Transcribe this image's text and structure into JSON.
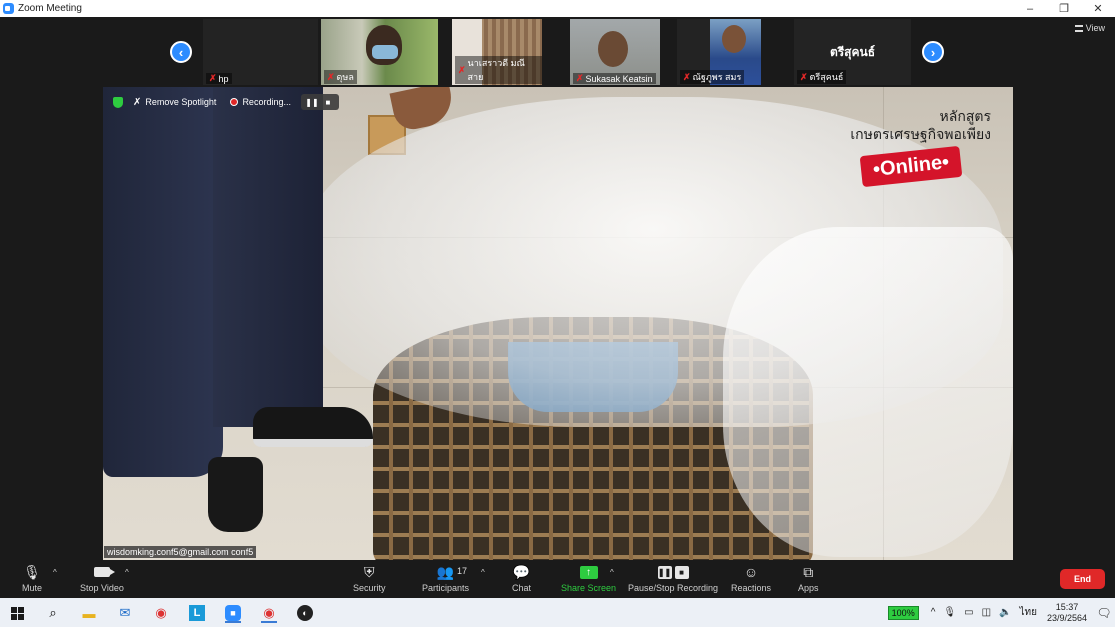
{
  "window": {
    "title": "Zoom Meeting",
    "controls": [
      "–",
      "❐",
      "✕"
    ]
  },
  "view_button": {
    "label": "View"
  },
  "thumbnails": [
    {
      "name": "hp",
      "muted": true,
      "kind": "name-only"
    },
    {
      "name": "ดุษล",
      "muted": true,
      "kind": "video"
    },
    {
      "name": "นาเสราวดี มณีสาย",
      "muted": true,
      "kind": "video"
    },
    {
      "name": "Sukasak Keatsin",
      "muted": true,
      "kind": "video"
    },
    {
      "name": "ณัฐภูพร สมร",
      "muted": true,
      "kind": "video"
    },
    {
      "name": "ตรีสุคนธ์",
      "display_name": "ตรีสุคนธ์",
      "muted": true,
      "kind": "name-only"
    }
  ],
  "spotlight_bar": {
    "remove_spotlight": "Remove Spotlight",
    "recording": "Recording...",
    "pause_glyph": "❚❚",
    "stop_glyph": "■"
  },
  "overlay": {
    "line1": "หลักสูตร",
    "line2": "เกษตรเศรษฐกิจพอเพียง",
    "badge": "•Online•"
  },
  "email_tag": "wisdomking.conf5@gmail.com conf5",
  "toolbar": {
    "mute": "Mute",
    "stop_video": "Stop Video",
    "security": "Security",
    "participants": "Participants",
    "participants_count": "17",
    "chat": "Chat",
    "share_screen": "Share Screen",
    "pause_stop_recording": "Pause/Stop Recording",
    "reactions": "Reactions",
    "apps": "Apps",
    "end": "End"
  },
  "taskbar": {
    "battery": "100%",
    "language": "ไทย",
    "time": "15:37",
    "date": "23/9/2564"
  },
  "colors": {
    "zoom_blue": "#2d8cff",
    "end_red": "#e02828",
    "share_green": "#2ecc40"
  }
}
